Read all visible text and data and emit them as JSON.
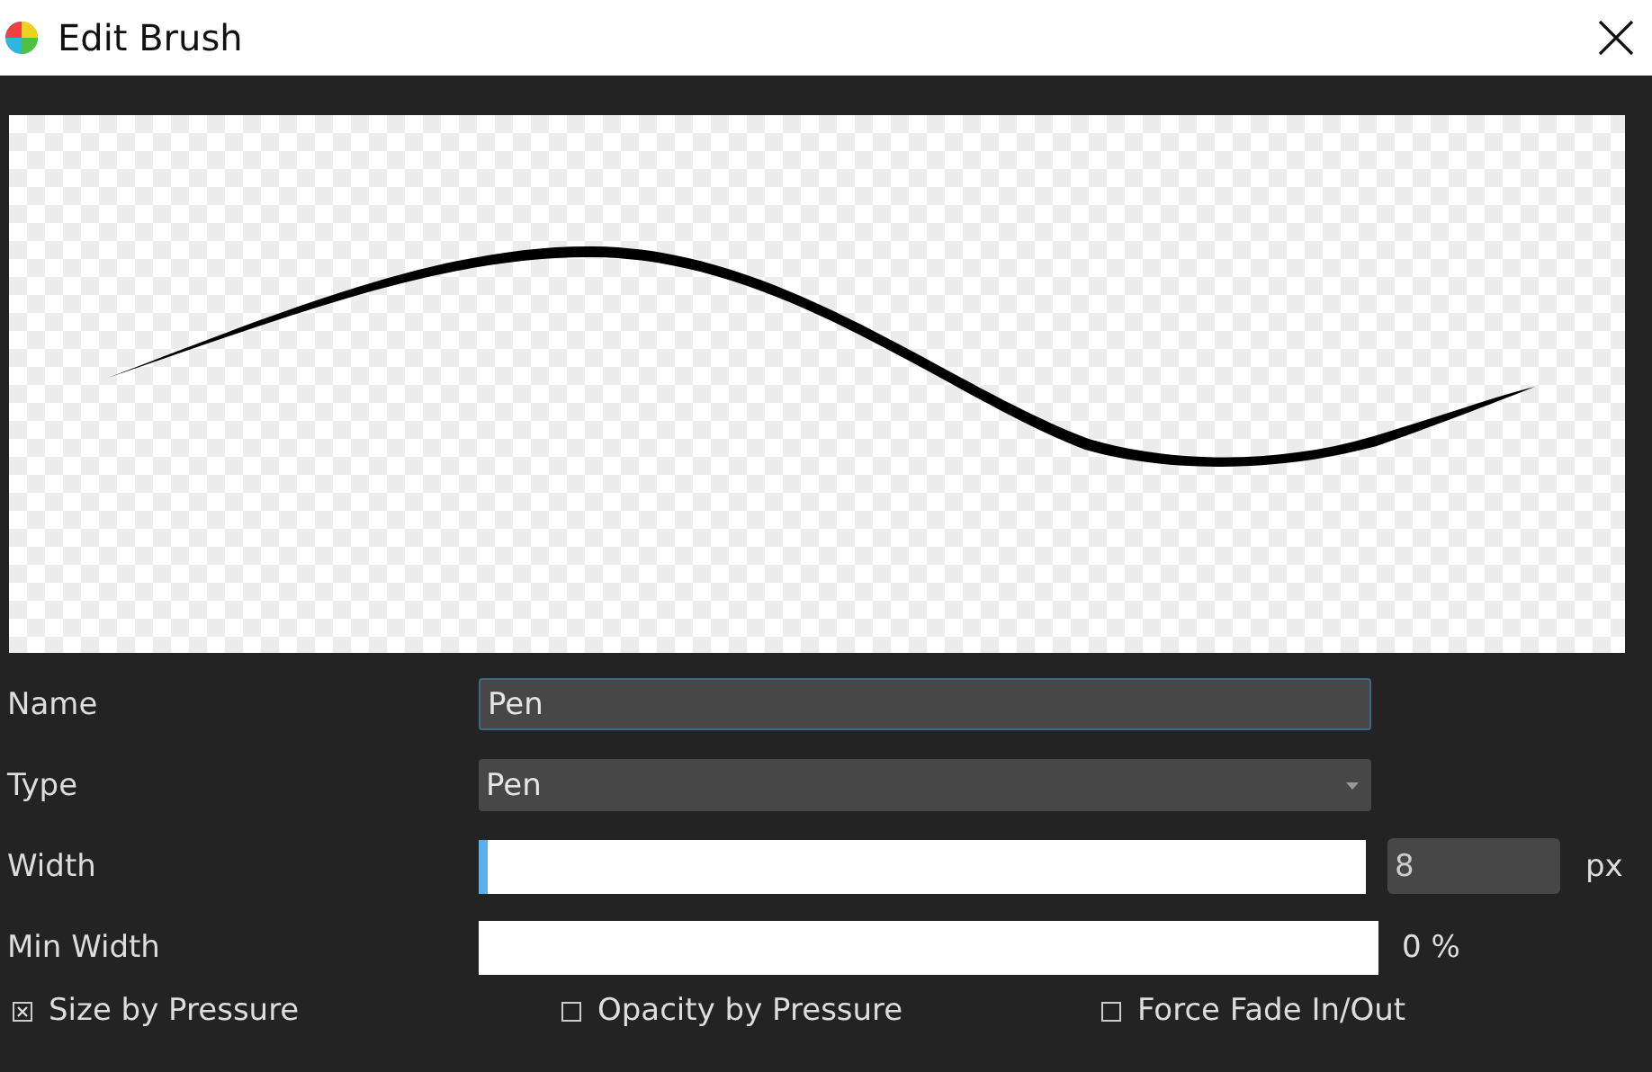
{
  "window": {
    "title": "Edit Brush"
  },
  "fields": [
    {
      "kind": "text",
      "label": "Name",
      "value": "Pen"
    },
    {
      "kind": "select",
      "label": "Type",
      "value": "Pen"
    },
    {
      "kind": "slider",
      "label": "Width",
      "level": 0,
      "value": "8",
      "unit": "px"
    },
    {
      "kind": "bar",
      "label": "Min Width",
      "reading": "0 %"
    }
  ],
  "options": [
    {
      "label": "Size by Pressure",
      "checked": true
    },
    {
      "label": "Opacity by Pressure",
      "checked": false
    },
    {
      "label": "Force Fade In/Out",
      "checked": false
    }
  ]
}
